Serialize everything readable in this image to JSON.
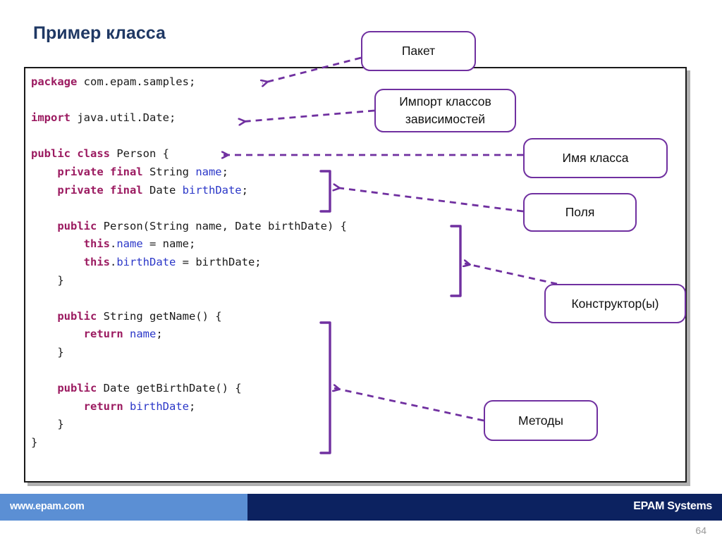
{
  "slide": {
    "title": "Пример класса",
    "page_number": "64"
  },
  "code": {
    "language": "java",
    "lines": [
      [
        {
          "t": "package",
          "c": "kw"
        },
        {
          "t": " com.epam.samples;",
          "c": "pl"
        }
      ],
      [],
      [
        {
          "t": "import",
          "c": "kw"
        },
        {
          "t": " java.util.Date;",
          "c": "pl"
        }
      ],
      [],
      [
        {
          "t": "public class",
          "c": "kw"
        },
        {
          "t": " Person {",
          "c": "pl"
        }
      ],
      [
        {
          "t": "    ",
          "c": "pl"
        },
        {
          "t": "private final",
          "c": "kw"
        },
        {
          "t": " String ",
          "c": "pl"
        },
        {
          "t": "name",
          "c": "id"
        },
        {
          "t": ";",
          "c": "pl"
        }
      ],
      [
        {
          "t": "    ",
          "c": "pl"
        },
        {
          "t": "private final",
          "c": "kw"
        },
        {
          "t": " Date ",
          "c": "pl"
        },
        {
          "t": "birthDate",
          "c": "id"
        },
        {
          "t": ";",
          "c": "pl"
        }
      ],
      [],
      [
        {
          "t": "    ",
          "c": "pl"
        },
        {
          "t": "public",
          "c": "kw"
        },
        {
          "t": " Person(String name, Date birthDate) {",
          "c": "pl"
        }
      ],
      [
        {
          "t": "        ",
          "c": "pl"
        },
        {
          "t": "this",
          "c": "kw"
        },
        {
          "t": ".",
          "c": "pl"
        },
        {
          "t": "name",
          "c": "id"
        },
        {
          "t": " = name;",
          "c": "pl"
        }
      ],
      [
        {
          "t": "        ",
          "c": "pl"
        },
        {
          "t": "this",
          "c": "kw"
        },
        {
          "t": ".",
          "c": "pl"
        },
        {
          "t": "birthDate",
          "c": "id"
        },
        {
          "t": " = birthDate;",
          "c": "pl"
        }
      ],
      [
        {
          "t": "    }",
          "c": "pl"
        }
      ],
      [],
      [
        {
          "t": "    ",
          "c": "pl"
        },
        {
          "t": "public",
          "c": "kw"
        },
        {
          "t": " String getName() {",
          "c": "pl"
        }
      ],
      [
        {
          "t": "        ",
          "c": "pl"
        },
        {
          "t": "return",
          "c": "kw"
        },
        {
          "t": " ",
          "c": "pl"
        },
        {
          "t": "name",
          "c": "id"
        },
        {
          "t": ";",
          "c": "pl"
        }
      ],
      [
        {
          "t": "    }",
          "c": "pl"
        }
      ],
      [],
      [
        {
          "t": "    ",
          "c": "pl"
        },
        {
          "t": "public",
          "c": "kw"
        },
        {
          "t": " Date getBirthDate() {",
          "c": "pl"
        }
      ],
      [
        {
          "t": "        ",
          "c": "pl"
        },
        {
          "t": "return",
          "c": "kw"
        },
        {
          "t": " ",
          "c": "pl"
        },
        {
          "t": "birthDate",
          "c": "id"
        },
        {
          "t": ";",
          "c": "pl"
        }
      ],
      [
        {
          "t": "    }",
          "c": "pl"
        }
      ],
      [
        {
          "t": "}",
          "c": "pl"
        }
      ]
    ]
  },
  "callouts": {
    "package": "Пакет",
    "imports": "Импорт классов\nзависимостей",
    "class_name": "Имя класса",
    "fields": "Поля",
    "constructors": "Конструктор(ы)",
    "methods": "Методы"
  },
  "footer": {
    "url": "www.epam.com",
    "brand": "EPAM Systems"
  },
  "colors": {
    "title": "#1F3864",
    "keyword": "#9B1A60",
    "identifier": "#2B37C8",
    "annotation_purple": "#7030A0",
    "footer_left": "#5B8FD4",
    "footer_right": "#0C2260",
    "page_number": "#9A9A9A"
  }
}
